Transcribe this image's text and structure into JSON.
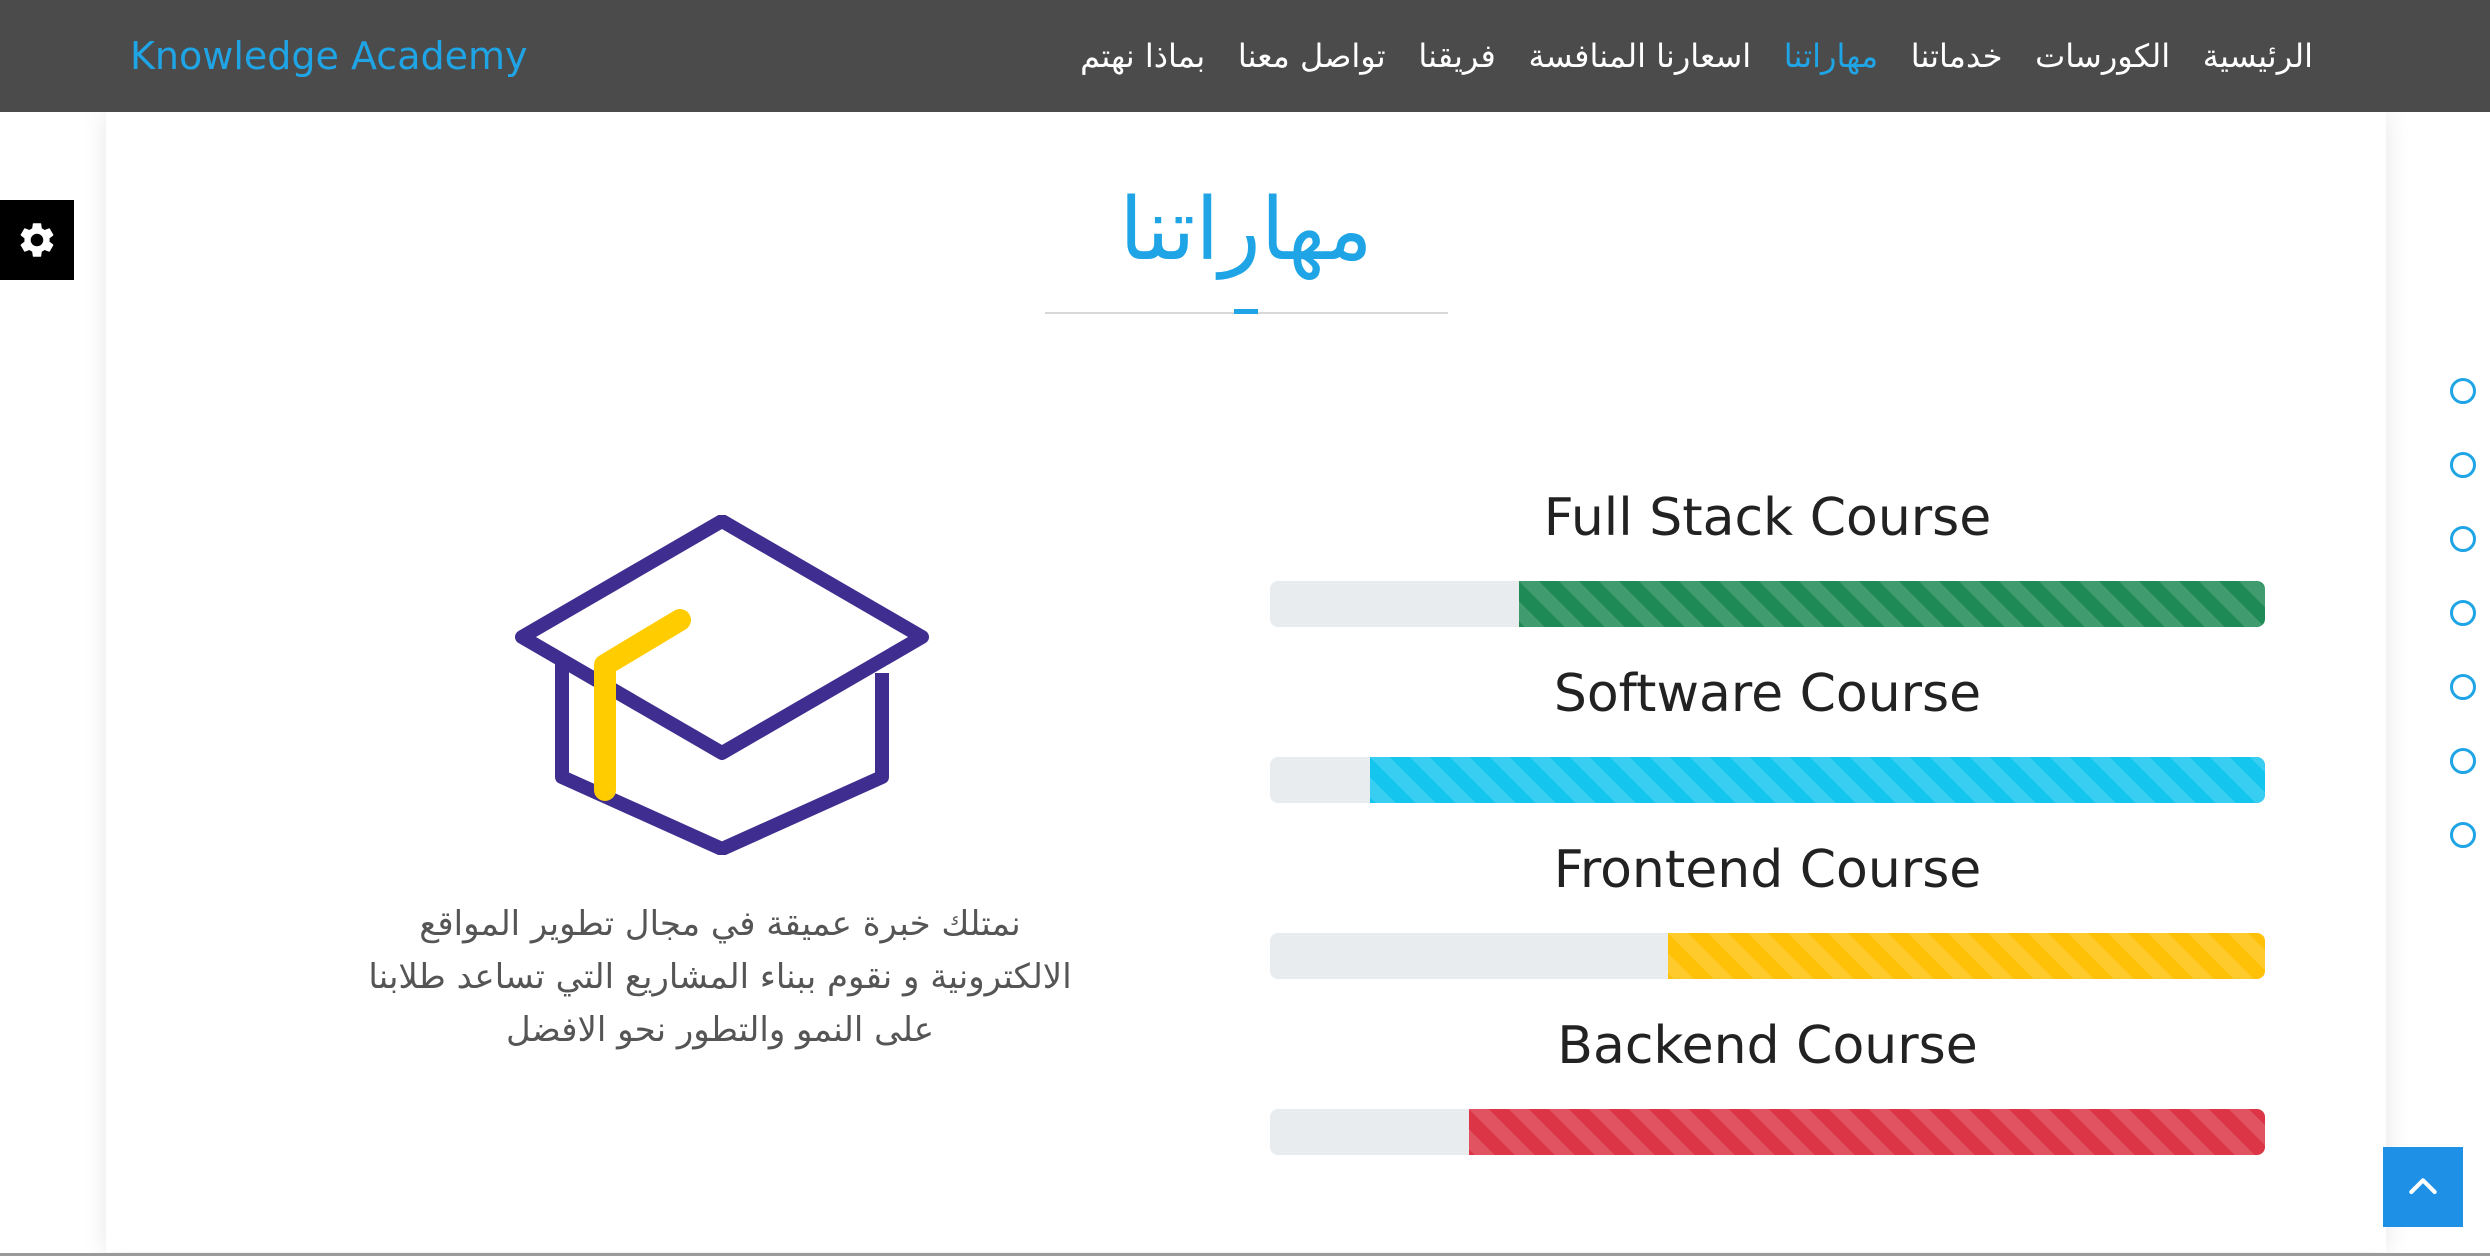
{
  "brand": "Knowledge Academy",
  "nav": [
    {
      "label": "الرئيسية",
      "active": false
    },
    {
      "label": "الكورسات",
      "active": false
    },
    {
      "label": "خدماتنا",
      "active": false
    },
    {
      "label": "مهاراتنا",
      "active": true
    },
    {
      "label": "اسعارنا المنافسة",
      "active": false
    },
    {
      "label": "فريقنا",
      "active": false
    },
    {
      "label": "تواصل معنا",
      "active": false
    },
    {
      "label": "بماذا نهتم",
      "active": false
    }
  ],
  "section_title": "مهاراتنا",
  "intro_lines": [
    "نمتلك خبرة عميقة في مجال تطوير المواقع",
    "الالكترونية و نقوم ببناء المشاريع التي تساعد طلابنا",
    "على النمو والتطور نحو الافضل"
  ],
  "skills": [
    {
      "name": "Full Stack Course",
      "progress_percent": 75,
      "color": "#1e8a55"
    },
    {
      "name": "Software Course",
      "progress_percent": 90,
      "color": "#14c6ee"
    },
    {
      "name": "Frontend Course",
      "progress_percent": 60,
      "color": "#ffc107"
    },
    {
      "name": "Backend Course",
      "progress_percent": 80,
      "color": "#dc3545"
    }
  ],
  "side_dots_count": 7,
  "icons": {
    "settings": "gear-icon",
    "back_to_top": "chevron-up-icon",
    "illustration": "graduation-cap-icon"
  },
  "colors": {
    "accent": "#1fa5e6",
    "navbar": "#4b4b4b",
    "cap_primary": "#3f2d8f",
    "cap_secondary": "#ffcc00"
  }
}
